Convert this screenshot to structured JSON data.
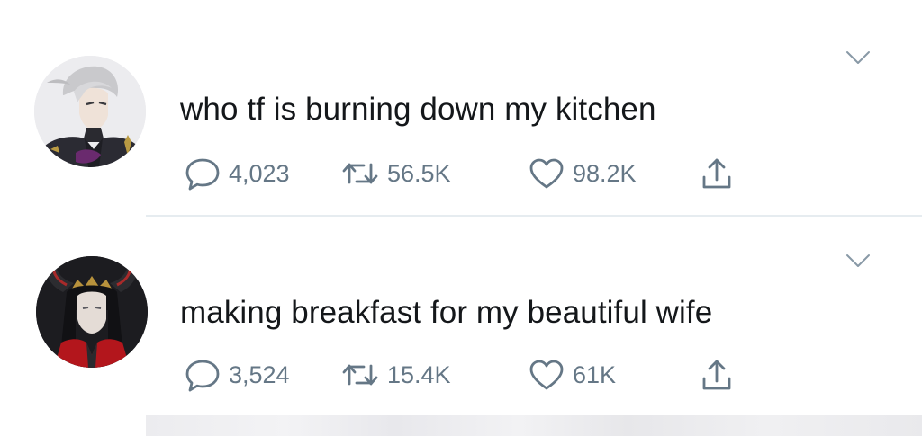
{
  "tweets": [
    {
      "text": "who tf is burning down my kitchen",
      "replies": "4,023",
      "retweets": "56.5K",
      "likes": "98.2K",
      "avatar_icon": "gray-haired-uniform-avatar"
    },
    {
      "text": "making breakfast for my beautiful wife",
      "replies": "3,524",
      "retweets": "15.4K",
      "likes": "61K",
      "avatar_icon": "horned-crown-avatar"
    }
  ],
  "colors": {
    "text": "#14171a",
    "secondary": "#657786",
    "divider": "#e6ecf0",
    "background": "#ffffff"
  },
  "icons": {
    "reply": "speech-bubble-icon",
    "retweet": "retweet-arrows-icon",
    "like": "heart-icon",
    "share": "share-upload-icon",
    "menu": "chevron-down-icon"
  }
}
